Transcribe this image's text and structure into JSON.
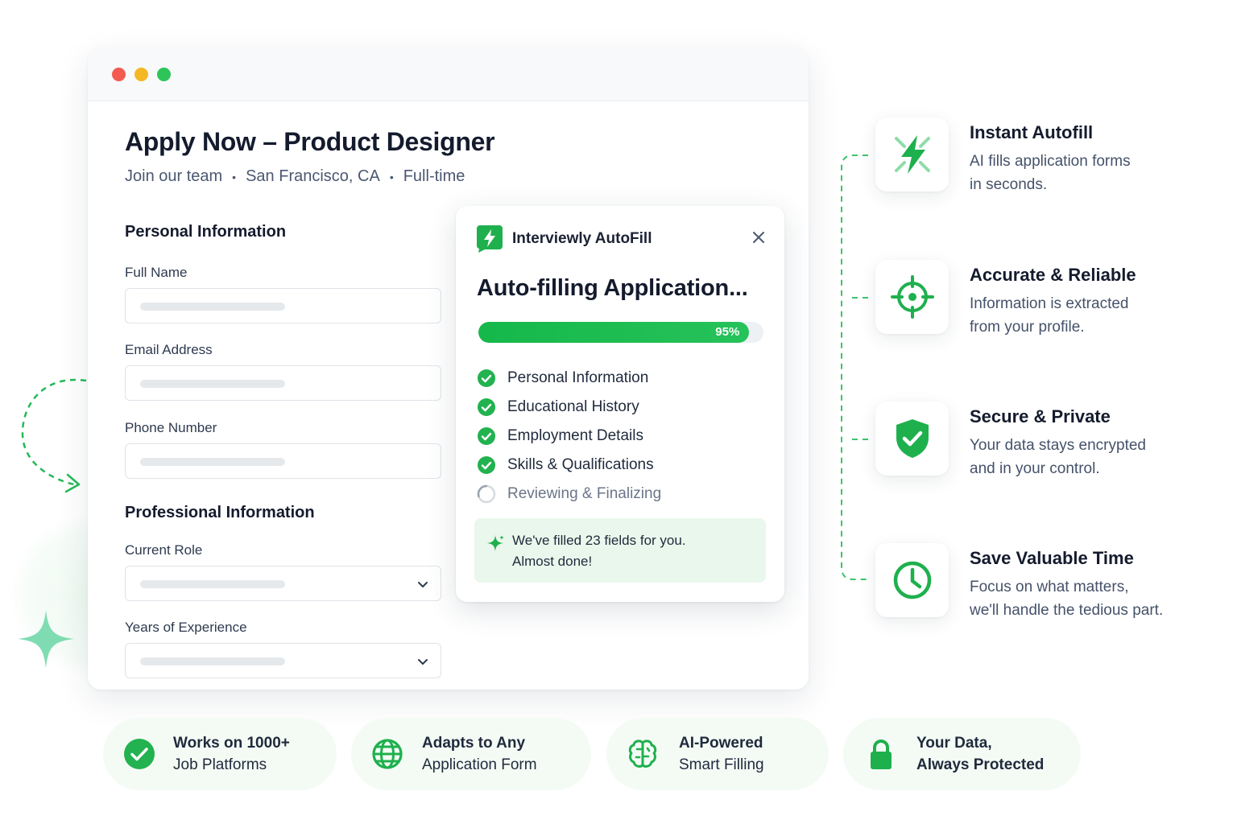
{
  "window": {
    "controls": [
      "close",
      "minimize",
      "maximize"
    ]
  },
  "job": {
    "title": "Apply Now – Product Designer",
    "team": "Join our team",
    "location": "San Francisco, CA",
    "type": "Full-time",
    "separator": "•"
  },
  "form": {
    "personal_section": "Personal Information",
    "full_name_label": "Full Name",
    "email_label": "Email Address",
    "phone_label": "Phone Number",
    "professional_section": "Professional Information",
    "current_role_label": "Current Role",
    "experience_label": "Years of Experience"
  },
  "popup": {
    "brand": "Interviewly AutoFill",
    "title": "Auto-filling Application...",
    "progress_percent": 95,
    "progress_label": "95%",
    "steps": [
      {
        "label": "Personal Information",
        "status": "done"
      },
      {
        "label": "Educational History",
        "status": "done"
      },
      {
        "label": "Employment Details",
        "status": "done"
      },
      {
        "label": "Skills & Qualifications",
        "status": "done"
      },
      {
        "label": "Reviewing & Finalizing",
        "status": "in-progress"
      }
    ],
    "note_line1": "We've filled 23 fields for you.",
    "note_line2": "Almost done!"
  },
  "features": [
    {
      "title": "Instant Autofill",
      "desc_line1": "AI fills application forms",
      "desc_line2": "in seconds.",
      "icon": "lightning-icon"
    },
    {
      "title": "Accurate & Reliable",
      "desc_line1": "Information is extracted",
      "desc_line2": "from your profile.",
      "icon": "crosshair-icon"
    },
    {
      "title": "Secure & Private",
      "desc_line1": "Your data stays encrypted",
      "desc_line2": "and in your control.",
      "icon": "shield-check-icon"
    },
    {
      "title": "Save Valuable Time",
      "desc_line1": "Focus on what matters,",
      "desc_line2": "we'll handle the tedious part.",
      "icon": "clock-icon"
    }
  ],
  "badges": [
    {
      "line1": "Works on 1000+",
      "line2": "Job Platforms",
      "icon": "check-circle-icon"
    },
    {
      "line1": "Adapts to Any",
      "line2": "Application Form",
      "icon": "globe-icon"
    },
    {
      "line1": "AI-Powered",
      "line2": "Smart Filling",
      "icon": "brain-icon"
    },
    {
      "line1": "Your Data,",
      "line2": "Always Protected",
      "icon": "lock-icon"
    }
  ],
  "colors": {
    "brand_green": "#1fb04e",
    "dot_red": "#f25a52",
    "dot_yellow": "#f5b825",
    "dot_green": "#2dc55a",
    "note_bg": "#eaf7ec"
  }
}
